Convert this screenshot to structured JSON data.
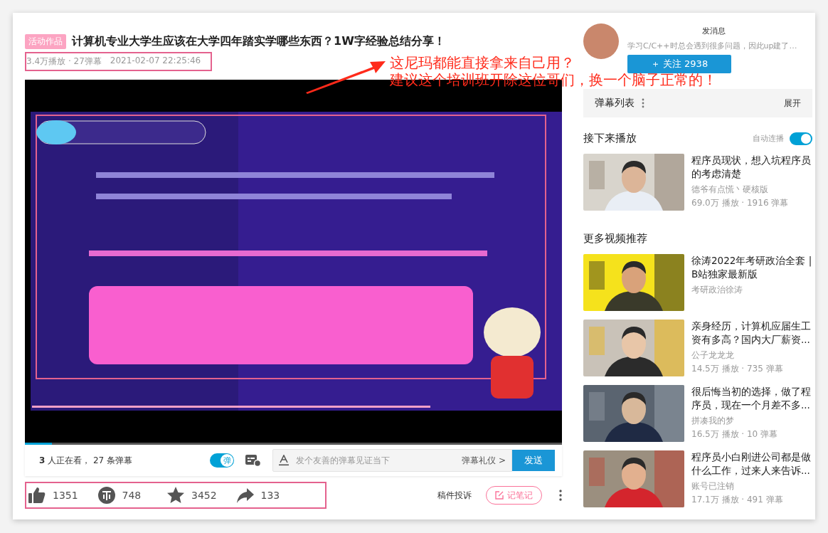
{
  "video": {
    "tag": "活动作品",
    "title": "计算机专业大学生应该在大学四年踏实学哪些东西？1W字经验总结分享！",
    "stats": "3.4万播放 · 27弹幕",
    "date": "2021-02-07 22:25:46"
  },
  "annotation": {
    "lines": [
      "这尼玛都能直接拿来自己用？",
      "建议这个培训班开除这位哥们，换一个脑子正常的！"
    ]
  },
  "player": {
    "progress": {
      "level": 0.05
    },
    "watching": "**3** 人正在看， 27 条弹幕",
    "danmaku_toggle": {
      "label": "弹",
      "on": true
    },
    "input": {
      "placeholder": "发个友善的弹幕见证当下"
    },
    "etiquette": "弹幕礼仪 >",
    "send": "发送"
  },
  "actions": {
    "like": "1351",
    "coin": "748",
    "favorite": "3452",
    "share": "133",
    "report": "稿件投诉",
    "notes": "记笔记"
  },
  "uploader": {
    "message": "发消息",
    "description": "学习C/C++时总会遇到很多问题，因此up建了…",
    "follow": "＋  关注 2938"
  },
  "danmaku_list": {
    "title": "弹幕列表",
    "expand": "展开"
  },
  "next_up": {
    "title": "接下来播放",
    "autoplay_label": "自动连播",
    "autoplay": true
  },
  "next_video": {
    "title": "程序员现状，想入坑程序员的考虑清楚",
    "author": "德爷有点慌丶硬核版",
    "stats": "69.0万 播放 · 1916 弹幕"
  },
  "more_title": "更多视频推荐",
  "recommendations": [
    {
      "title": "徐涛2022年考研政治全套 | B站独家最新版",
      "author": "考研政治徐涛"
    },
    {
      "title": "亲身经历，计算机应届生工资有多高？国内大厂薪资...",
      "author": "公子龙龙龙",
      "stats": "14.5万 播放 · 735 弹幕"
    },
    {
      "title": "很后悔当初的选择，做了程序员，现在一个月差不多...",
      "author": "拼凑我的梦",
      "stats": "16.5万 播放 · 10 弹幕"
    },
    {
      "title": "程序员小白刚进公司都是做什么工作，过来人来告诉...",
      "author": "账号已注销",
      "stats": "17.1万 播放 · 491 弹幕"
    }
  ]
}
